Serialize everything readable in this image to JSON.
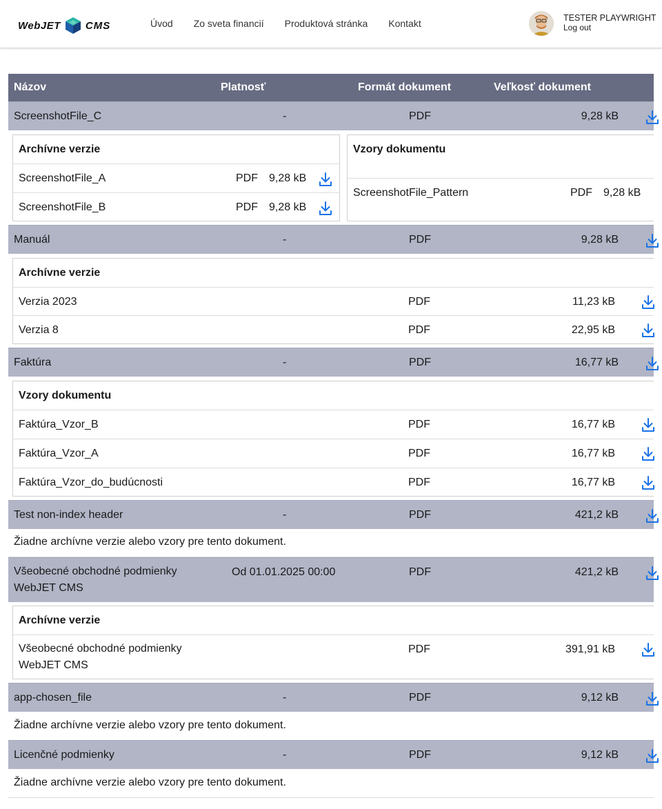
{
  "brand": {
    "logo_left": "WebJET",
    "logo_right": "CMS"
  },
  "nav": [
    "Úvod",
    "Zo sveta financií",
    "Produktová stránka",
    "Kontakt"
  ],
  "user": {
    "name": "TESTER PLAYWRIGHT",
    "logout": "Log out"
  },
  "table": {
    "headers": {
      "name": "Názov",
      "validity": "Platnosť",
      "format": "Formát dokument",
      "size": "Veľkosť dokument"
    },
    "rows": [
      {
        "name": "ScreenshotFile_C",
        "validity": "-",
        "format": "PDF",
        "size": "9,28 kB"
      },
      {
        "name": "Manuál",
        "validity": "-",
        "format": "PDF",
        "size": "9,28 kB"
      },
      {
        "name": "Faktúra",
        "validity": "-",
        "format": "PDF",
        "size": "16,77 kB"
      },
      {
        "name": "Test non-index header",
        "validity": "-",
        "format": "PDF",
        "size": "421,2 kB"
      },
      {
        "name_line1": "Všeobecné obchodné podmienky",
        "name_line2": "WebJET CMS",
        "validity": "Od 01.01.2025 00:00",
        "format": "PDF",
        "size": "421,2 kB"
      },
      {
        "name": "app-chosen_file",
        "validity": "-",
        "format": "PDF",
        "size": "9,12 kB"
      },
      {
        "name": "Licenčné podmienky",
        "validity": "-",
        "format": "PDF",
        "size": "9,12 kB"
      }
    ]
  },
  "labels": {
    "archive": "Archívne verzie",
    "patterns": "Vzory dokumentu",
    "none": "Žiadne archívne verzie alebo vzory pre tento dokument."
  },
  "sub": {
    "r0_archive": [
      {
        "name": "ScreenshotFile_A",
        "format": "PDF",
        "size": "9,28 kB"
      },
      {
        "name": "ScreenshotFile_B",
        "format": "PDF",
        "size": "9,28 kB"
      }
    ],
    "r0_patterns": [
      {
        "name": "ScreenshotFile_Pattern",
        "format": "PDF",
        "size": "9,28 kB"
      }
    ],
    "r1_archive": [
      {
        "name": "Verzia 2023",
        "format": "PDF",
        "size": "11,23 kB"
      },
      {
        "name": "Verzia 8",
        "format": "PDF",
        "size": "22,95 kB"
      }
    ],
    "r2_patterns": [
      {
        "name": "Faktúra_Vzor_B",
        "format": "PDF",
        "size": "16,77 kB"
      },
      {
        "name": "Faktúra_Vzor_A",
        "format": "PDF",
        "size": "16,77 kB"
      },
      {
        "name": "Faktúra_Vzor_do_budúcnosti",
        "format": "PDF",
        "size": "16,77 kB"
      }
    ],
    "r4_archive": [
      {
        "name_line1": "Všeobecné obchodné podmienky",
        "name_line2": "WebJET CMS",
        "format": "PDF",
        "size": "391,91 kB"
      }
    ]
  },
  "colors": {
    "header_bg": "#676c83",
    "row_bg": "#b1b5c6",
    "icon": "#1a73e8"
  }
}
